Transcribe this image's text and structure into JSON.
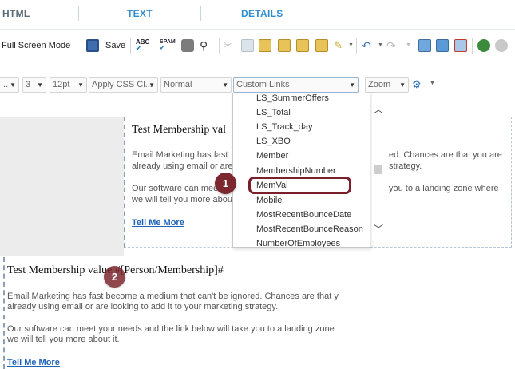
{
  "tabs": [
    {
      "label": "HTML"
    },
    {
      "label": "TEXT"
    },
    {
      "label": "DETAILS"
    }
  ],
  "toolbar1": {
    "full_screen_label": "Full Screen Mode",
    "save_label": "Save",
    "icons": [
      "save-icon",
      "spellcheck-icon",
      "spellcheck-dropdown-icon",
      "print-icon",
      "find-icon",
      "cut-icon",
      "copy-icon",
      "paste-icon",
      "paste-text-icon",
      "paste-word-icon",
      "format-painter-icon",
      "undo-icon",
      "redo-icon",
      "image-icon",
      "flash-icon",
      "media-icon",
      "link-icon",
      "unlink-icon"
    ]
  },
  "toolbar2": {
    "font_name": "...",
    "font_size": "3",
    "font_size_pt": "12pt",
    "css_class": "Apply CSS Cl...",
    "paragraph_style": "Normal",
    "custom_links": "Custom Links",
    "zoom": "Zoom"
  },
  "dropdown": {
    "items": [
      "LS_SummerOffers",
      "LS_Total",
      "LS_Track_day",
      "LS_XBO",
      "Member",
      "MembershipNumber",
      "MemVal",
      "Mobile",
      "MostRecentBounceDate",
      "MostRecentBounceReason",
      "NumberOfEmployees"
    ],
    "highlighted": "MemVal"
  },
  "preview": {
    "title": "Test Membership val",
    "p1_line1": "Email Marketing has fast",
    "p1_line1_end": "ed. Chances are that you are",
    "p1_line2": "already using email or are",
    "p1_line2_end": "strategy.",
    "p2_line1": "Our software can meet y",
    "p2_line1_end": "you to a landing zone where",
    "p2_line2": "we will tell you more abou",
    "link": "Tell Me More"
  },
  "editor": {
    "title": "Test Membership value #[Person/Membership]#",
    "p1_line1": "Email Marketing has fast become a medium that can't be ignored. Chances are that y",
    "p1_line2": "already using email or are looking to add it to your marketing strategy.",
    "p2_line1": "Our software can meet your needs and the link below will take you to a landing zone",
    "p2_line2": "we will tell you more about it.",
    "link": "Tell Me More"
  },
  "callouts": [
    "1",
    "2"
  ],
  "colors": {
    "tab_active": "#2f8ed0",
    "callout": "#7c2730",
    "highlight_border": "#7a1f2b",
    "link": "#1e63b8"
  }
}
